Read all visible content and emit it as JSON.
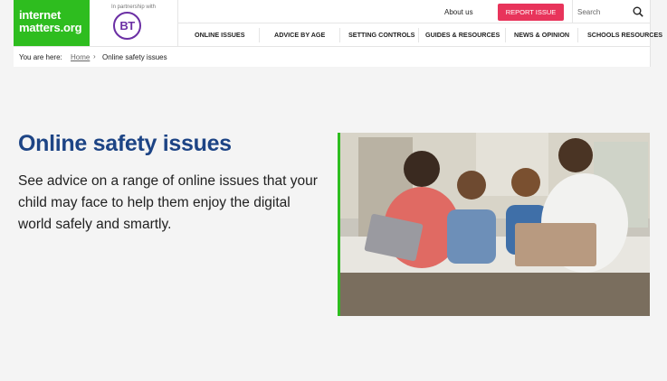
{
  "brand": {
    "logo_line1": "internet",
    "logo_line2": "matters.org",
    "partner_text": "In partnership with",
    "partner_logo": "BT"
  },
  "utility": {
    "about": "About us",
    "report": "REPORT ISSUE",
    "search_placeholder": "Search"
  },
  "nav": {
    "items": [
      "ONLINE ISSUES",
      "ADVICE BY AGE",
      "SETTING CONTROLS",
      "GUIDES & RESOURCES",
      "NEWS & OPINION",
      "SCHOOLS RESOURCES"
    ]
  },
  "breadcrumb": {
    "prefix": "You are here:",
    "home": "Home",
    "separator": "›",
    "current": "Online safety issues"
  },
  "hero": {
    "title": "Online safety issues",
    "intro": "See advice on a range of online issues that your child may face to help them enjoy the digital world safely and smartly."
  },
  "colors": {
    "brand_green": "#2ebd1f",
    "report_pink": "#e8345b",
    "title_blue": "#1d4485",
    "bt_purple": "#6b2fa4"
  },
  "icons": {
    "search": "search-icon"
  }
}
